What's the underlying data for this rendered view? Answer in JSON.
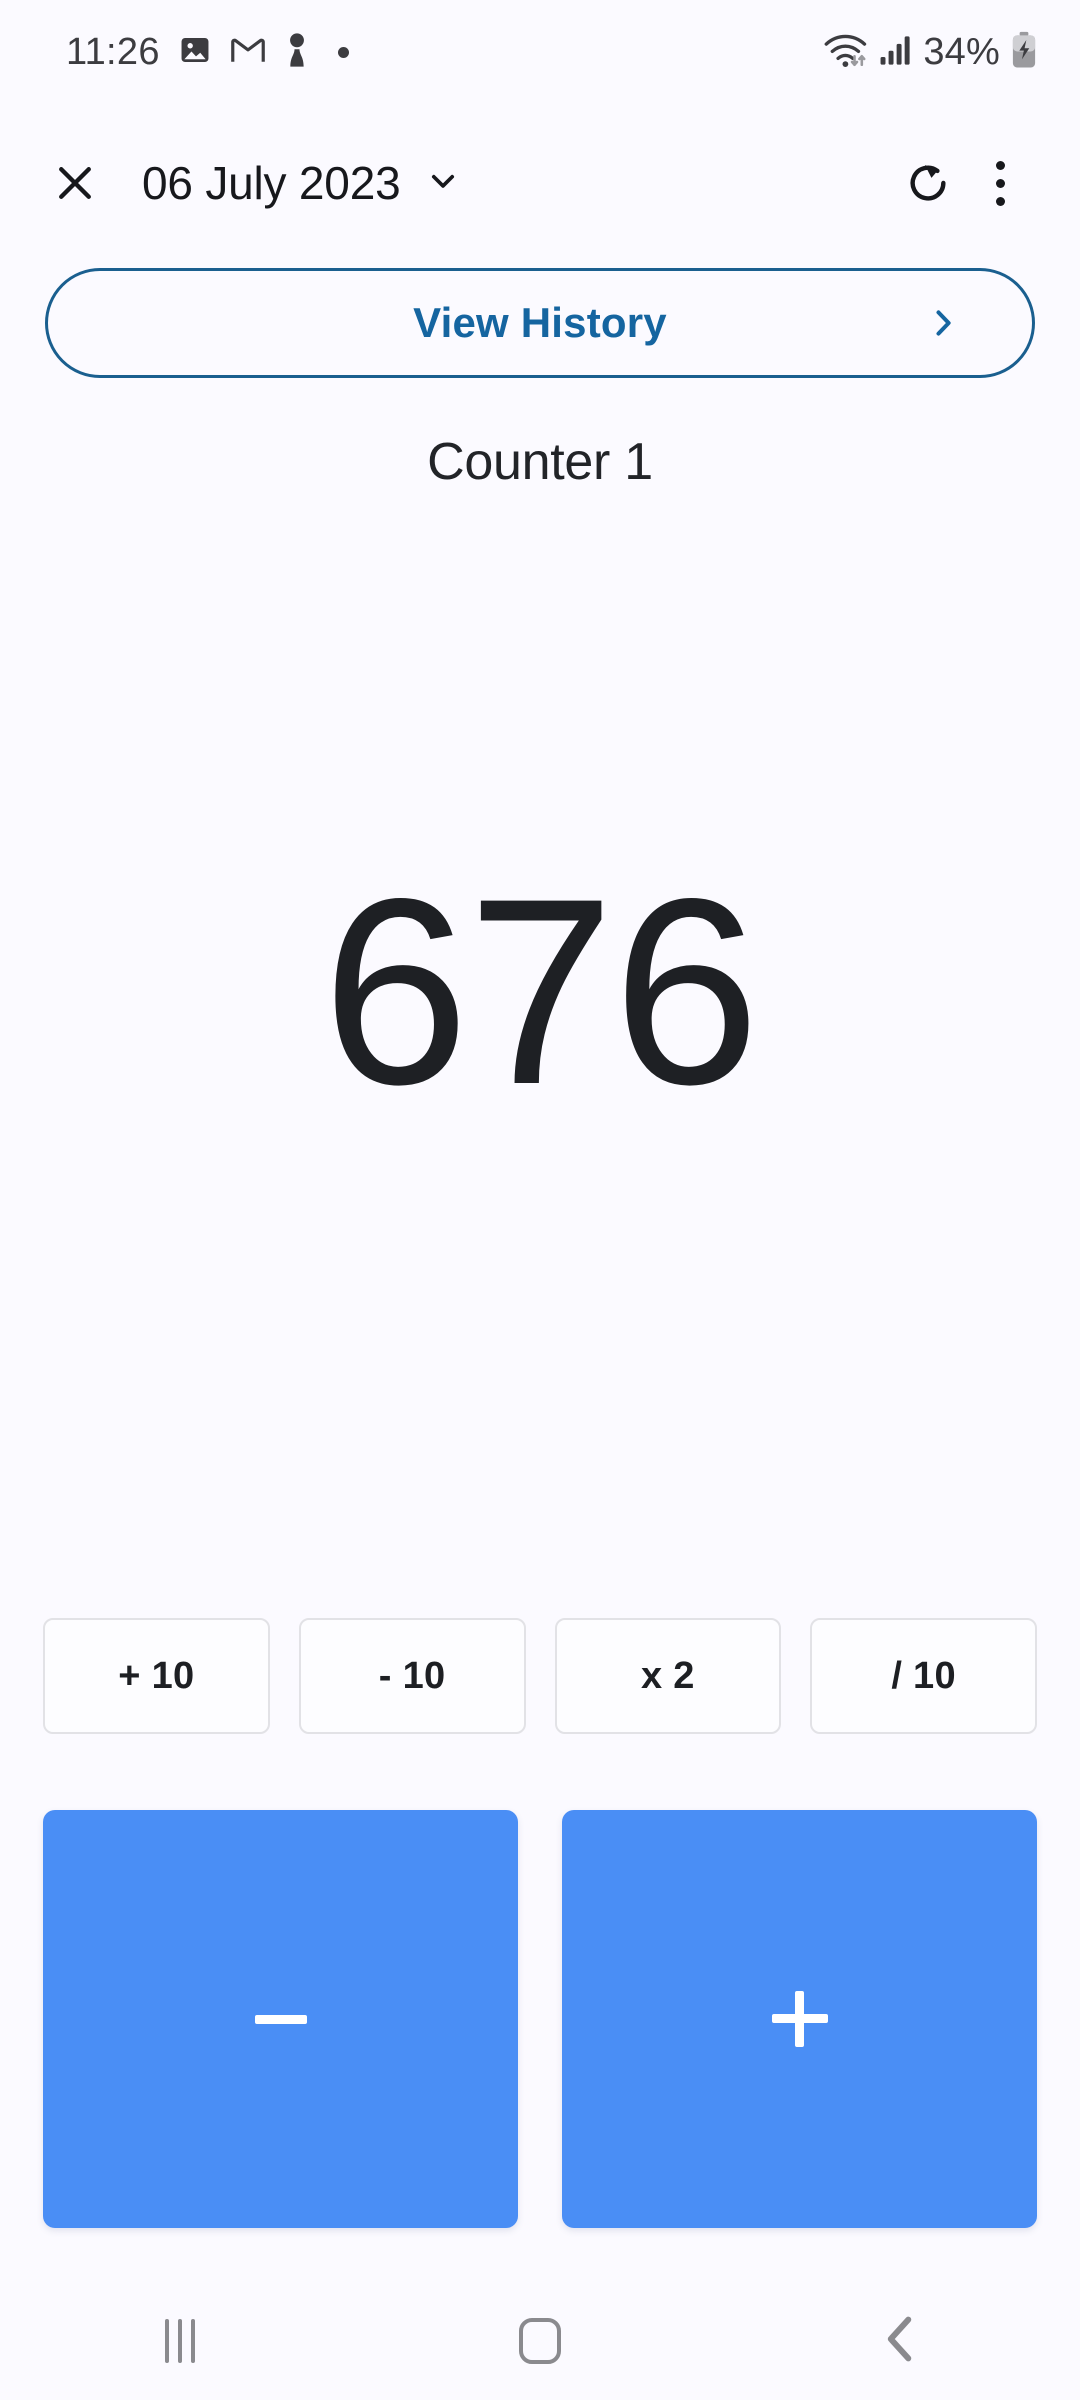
{
  "status_bar": {
    "time": "11:26",
    "left_icons": [
      "photos-icon",
      "gmail-icon",
      "pawn-icon",
      "dot-icon"
    ],
    "right_icons": [
      "wifi-icon",
      "cellular-signal-icon",
      "battery-charging-icon"
    ],
    "battery_percent": "34%",
    "text_color": "#3c3c40"
  },
  "app_bar": {
    "close_icon": "close-icon",
    "date": "06 July 2023",
    "dropdown_icon": "chevron-down-icon",
    "reset_icon": "reset-icon",
    "overflow_icon": "overflow-menu-icon"
  },
  "history": {
    "label": "View History",
    "chevron_icon": "chevron-right-icon",
    "border_color": "#1a5f8f",
    "text_color": "#1565a0"
  },
  "counter": {
    "name": "Counter 1",
    "value": "676",
    "value_color": "#1e2024"
  },
  "quick_actions": [
    {
      "label": "+ 10",
      "name": "plus-ten"
    },
    {
      "label": "- 10",
      "name": "minus-ten"
    },
    {
      "label": "x 2",
      "name": "times-two"
    },
    {
      "label": "/ 10",
      "name": "divide-ten"
    }
  ],
  "big_buttons": [
    {
      "name": "decrement",
      "glyph": "minus-icon"
    },
    {
      "name": "increment",
      "glyph": "plus-icon"
    }
  ],
  "theme": {
    "background": "#fbfaff",
    "accent_blue": "#4a8ef5",
    "quick_border": "#e2e2e6"
  },
  "nav_bar": {
    "recents_icon": "recents-icon",
    "home_icon": "home-icon",
    "back_icon": "back-icon",
    "icon_color": "#8a8a8e"
  }
}
